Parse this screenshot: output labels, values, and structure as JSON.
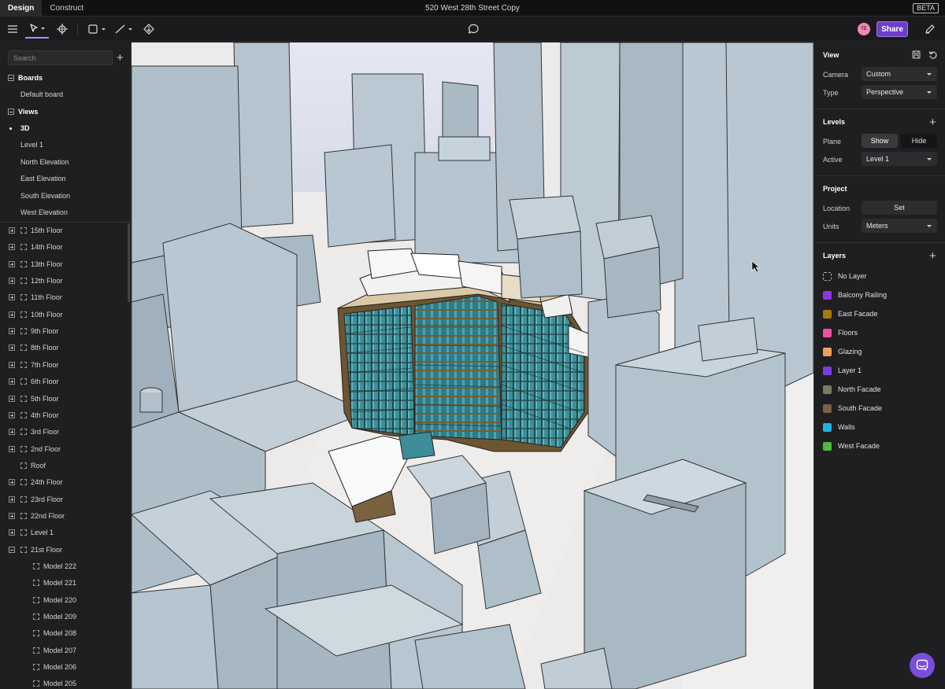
{
  "topbar": {
    "tabs": [
      {
        "label": "Design"
      },
      {
        "label": "Construct"
      }
    ],
    "title": "520 West 28th Street Copy",
    "badge": "BETA"
  },
  "toolbar": {
    "icons": [
      "menu-icon",
      "select-cursor-icon",
      "move-icon",
      "rectangle-icon",
      "line-icon",
      "extrude-icon",
      "comment-icon",
      "pen-icon"
    ],
    "avatar_initials": "TE",
    "share_label": "Share"
  },
  "sidebar": {
    "search_placeholder": "Search",
    "boards_header": "Boards",
    "boards": [
      {
        "label": "Default board"
      }
    ],
    "views_header": "Views",
    "views": [
      {
        "label": "3D",
        "current": true
      },
      {
        "label": "Level 1"
      },
      {
        "label": "North Elevation"
      },
      {
        "label": "East Elevation"
      },
      {
        "label": "South Elevation"
      },
      {
        "label": "West Elevation"
      }
    ],
    "levels": [
      {
        "label": "15th Floor"
      },
      {
        "label": "14th Floor"
      },
      {
        "label": "13th Floor"
      },
      {
        "label": "12th Floor"
      },
      {
        "label": "11th Floor"
      },
      {
        "label": "10th Floor"
      },
      {
        "label": "9th Floor"
      },
      {
        "label": "8th Floor"
      },
      {
        "label": "7th Floor"
      },
      {
        "label": "6th Floor"
      },
      {
        "label": "5th Floor"
      },
      {
        "label": "4th Floor"
      },
      {
        "label": "3rd Floor"
      },
      {
        "label": "2nd Floor"
      },
      {
        "label": "Roof"
      },
      {
        "label": "24th Floor"
      },
      {
        "label": "23rd Floor"
      },
      {
        "label": "22nd Floor"
      },
      {
        "label": "Level 1"
      },
      {
        "label": "21st Floor"
      }
    ],
    "models": [
      {
        "label": "Model 222"
      },
      {
        "label": "Model 221"
      },
      {
        "label": "Model 220"
      },
      {
        "label": "Model 209"
      },
      {
        "label": "Model 208"
      },
      {
        "label": "Model 207"
      },
      {
        "label": "Model 206"
      },
      {
        "label": "Model 205"
      }
    ]
  },
  "panel": {
    "view_header": "View",
    "camera_label": "Camera",
    "camera_value": "Custom",
    "type_label": "Type",
    "type_value": "Perspective",
    "levels_header": "Levels",
    "plane_label": "Plane",
    "plane_show": "Show",
    "plane_hide": "Hide",
    "active_label": "Active",
    "active_value": "Level 1",
    "project_header": "Project",
    "location_label": "Location",
    "location_button": "Set",
    "units_label": "Units",
    "units_value": "Meters",
    "layers_header": "Layers",
    "layers": [
      {
        "label": "No Layer",
        "color": ""
      },
      {
        "label": "Balcony Railing",
        "color": "#8e35e6"
      },
      {
        "label": "East Facade",
        "color": "#a7780f"
      },
      {
        "label": "Floors",
        "color": "#ef4fa0"
      },
      {
        "label": "Glazing",
        "color": "#f1a05a"
      },
      {
        "label": "Layer 1",
        "color": "#7c3de0"
      },
      {
        "label": "North Facade",
        "color": "#7b7a63"
      },
      {
        "label": "South Facade",
        "color": "#7a6347"
      },
      {
        "label": "Walls",
        "color": "#21b3e0"
      },
      {
        "label": "West Facade",
        "color": "#4dbb3c"
      }
    ]
  }
}
